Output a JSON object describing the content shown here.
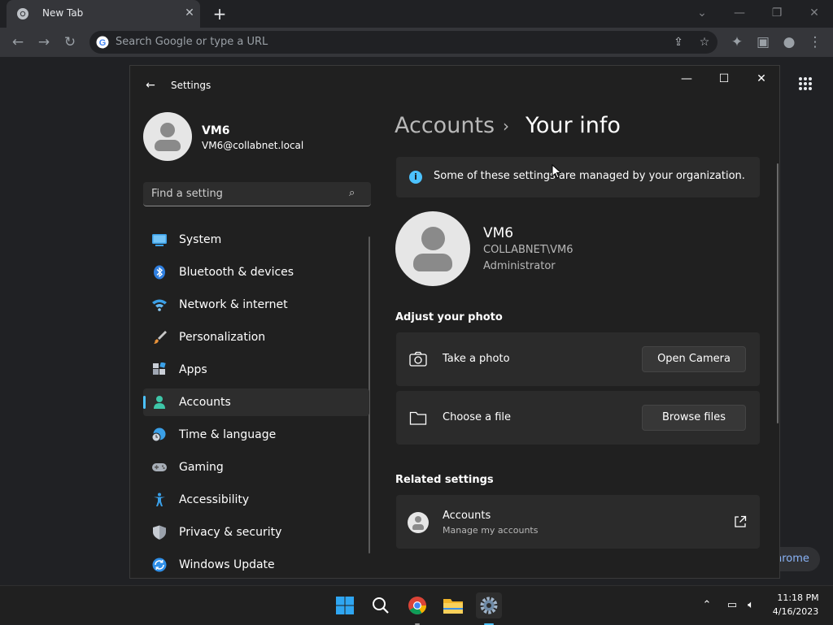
{
  "browser": {
    "tab_title": "New Tab",
    "tab_close": "✕",
    "new_tab": "+",
    "omnibox_placeholder": "Search Google or type a URL",
    "pill_text": "hrome",
    "window_controls": [
      "⌄",
      "—",
      "❐",
      "✕"
    ]
  },
  "settings": {
    "window_title": "Settings",
    "user": {
      "name": "VM6",
      "email": "VM6@collabnet.local"
    },
    "search_placeholder": "Find a setting",
    "nav": [
      {
        "label": "System",
        "icon": "monitor-icon",
        "selected": false
      },
      {
        "label": "Bluetooth & devices",
        "icon": "bluetooth-icon",
        "selected": false
      },
      {
        "label": "Network & internet",
        "icon": "wifi-icon",
        "selected": false
      },
      {
        "label": "Personalization",
        "icon": "brush-icon",
        "selected": false
      },
      {
        "label": "Apps",
        "icon": "apps-icon",
        "selected": false
      },
      {
        "label": "Accounts",
        "icon": "person-icon",
        "selected": true
      },
      {
        "label": "Time & language",
        "icon": "globe-clock-icon",
        "selected": false
      },
      {
        "label": "Gaming",
        "icon": "gamepad-icon",
        "selected": false
      },
      {
        "label": "Accessibility",
        "icon": "accessibility-icon",
        "selected": false
      },
      {
        "label": "Privacy & security",
        "icon": "shield-icon",
        "selected": false
      },
      {
        "label": "Windows Update",
        "icon": "update-icon",
        "selected": false
      }
    ],
    "breadcrumb": {
      "parent": "Accounts",
      "separator": "›",
      "current": "Your info"
    },
    "info_message": "Some of these settings are managed by your organization.",
    "account": {
      "name": "VM6",
      "domain": "COLLABNET\\VM6",
      "role": "Administrator"
    },
    "adjust_photo": {
      "heading": "Adjust your photo",
      "take_photo_label": "Take a photo",
      "open_camera_button": "Open Camera",
      "choose_file_label": "Choose a file",
      "browse_files_button": "Browse files"
    },
    "related": {
      "heading": "Related settings",
      "accounts_title": "Accounts",
      "accounts_sub": "Manage my accounts"
    }
  },
  "taskbar": {
    "time": "11:18 PM",
    "date": "4/16/2023"
  },
  "colors": {
    "accent": "#4cc2ff",
    "window_bg": "#202020",
    "card_bg": "#2b2b2b"
  }
}
